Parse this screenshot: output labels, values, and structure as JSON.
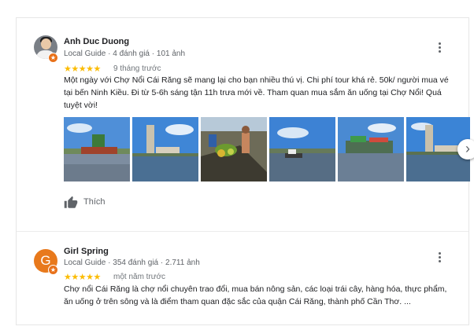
{
  "reviews": [
    {
      "author": "Anh Duc Duong",
      "guide": "Local Guide",
      "reviews_count": "4 đánh giá",
      "photos_count": "101 ảnh",
      "stars": "★★★★★",
      "rating": 5,
      "date": "9 tháng trước",
      "text": "Một ngày với Chợ Nổi Cái Răng sẽ mang lại cho bạn nhiều thú vị. Chi phí tour khá rẻ. 50k/ người mua vé tại bến Ninh Kiều. Đi từ 5-6h sáng tận 11h trưa mới về. Tham quan mua sắm ăn uống tại Chợ Nổi! Quá tuyệt vời!",
      "like_label": "Thích"
    },
    {
      "author": "Girl Spring",
      "avatar_letter": "G",
      "guide": "Local Guide",
      "reviews_count": "354 đánh giá",
      "photos_count": "2.711 ảnh",
      "stars": "★★★★★",
      "rating": 5,
      "date": "một năm trước",
      "text": "Chợ nổi Cái Răng là chợ nổi chuyên trao đổi, mua bán nông sản, các loại trái cây, hàng hóa, thực phẩm, ăn uống ở trên sông và là điểm tham quan đặc sắc của quận Cái Răng, thành phố Cần Thơ. ..."
    }
  ],
  "separator": "·",
  "colors": {
    "star": "#fbbc04",
    "guide_badge": "#e8711a",
    "avatar_bg": "#e8791c"
  },
  "icons": {
    "more": "more-vert-icon",
    "next": "chevron-right-icon",
    "like": "thumbs-up-icon"
  }
}
